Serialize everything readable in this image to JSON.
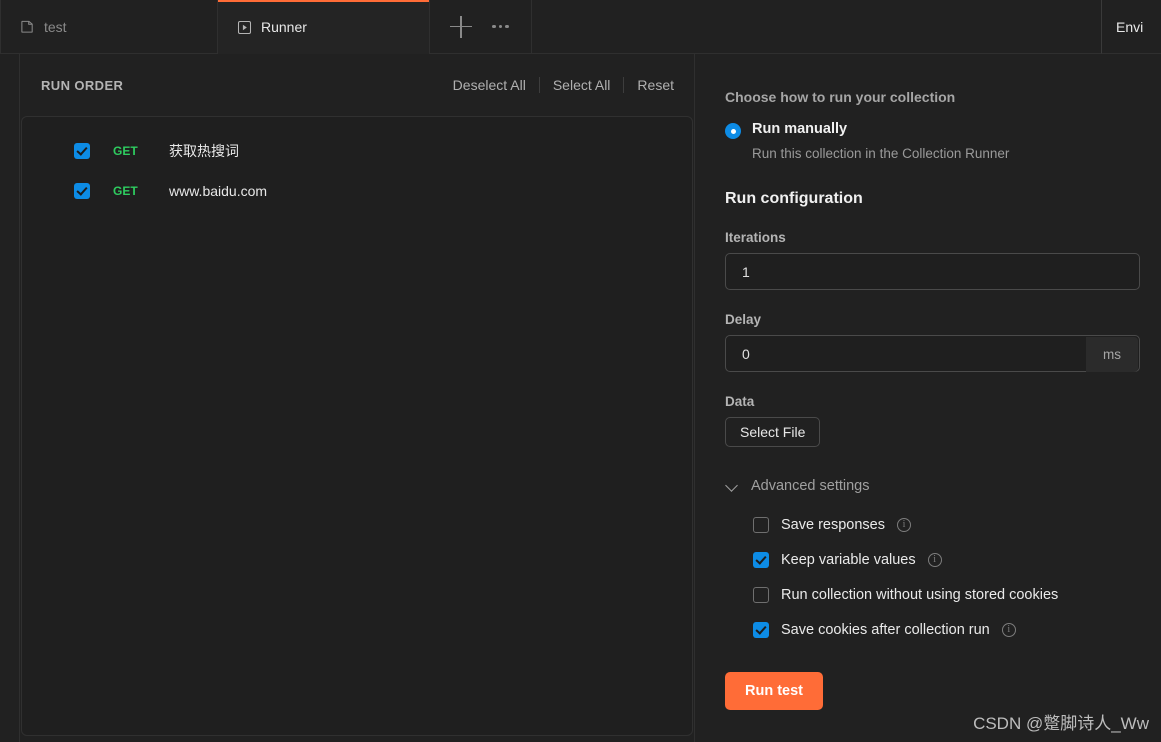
{
  "tabs": [
    {
      "label": "test",
      "icon": "collection-icon",
      "active": false
    },
    {
      "label": "Runner",
      "icon": "play-square-icon",
      "active": true
    }
  ],
  "tabbar": {
    "new_tab_label": "+",
    "more_label": "•••",
    "environment_label": "Envi"
  },
  "run_order": {
    "title": "RUN ORDER",
    "actions": [
      {
        "label": "Deselect All"
      },
      {
        "label": "Select All"
      },
      {
        "label": "Reset"
      }
    ],
    "items": [
      {
        "checked": true,
        "method": "GET",
        "name": "获取热搜词"
      },
      {
        "checked": true,
        "method": "GET",
        "name": "www.baidu.com"
      }
    ]
  },
  "config": {
    "choose_heading": "Choose how to run your collection",
    "run_mode": {
      "label": "Run manually",
      "description": "Run this collection in the Collection Runner",
      "selected": true
    },
    "section_title": "Run configuration",
    "iterations": {
      "label": "Iterations",
      "value": "1",
      "placeholder": "1"
    },
    "delay": {
      "label": "Delay",
      "value": "0",
      "placeholder": "0",
      "unit": "ms"
    },
    "data": {
      "label": "Data",
      "button_label": "Select File"
    },
    "advanced": {
      "label": "Advanced settings",
      "expanded": true,
      "options": [
        {
          "label": "Save responses",
          "checked": false,
          "info": true
        },
        {
          "label": "Keep variable values",
          "checked": true,
          "info": true
        },
        {
          "label": "Run collection without using stored cookies",
          "checked": false,
          "info": false
        },
        {
          "label": "Save cookies after collection run",
          "checked": true,
          "info": true
        }
      ]
    },
    "run_button_label": "Run test"
  },
  "watermark": "CSDN @蹩脚诗人_Ww",
  "colors": {
    "accent_orange": "#ff6c37",
    "checkbox_blue": "#0d8ce6",
    "method_green": "#2ecc5f",
    "background": "#212121"
  }
}
